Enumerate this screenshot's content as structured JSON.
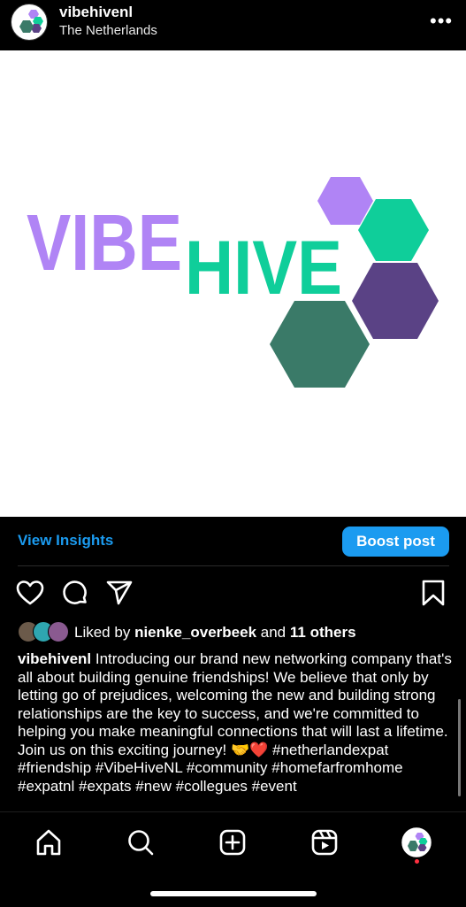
{
  "header": {
    "username": "vibehivenl",
    "location": "The Netherlands",
    "more_icon": "more-horizontal-icon"
  },
  "post": {
    "logo_text_1": "VIBE",
    "logo_text_2": "HIVE",
    "colors": {
      "purple_light": "#b084f5",
      "teal": "#0fce9a",
      "purple_dark": "#5a4285",
      "green_dark": "#3a7a68"
    }
  },
  "insights": {
    "view_insights": "View Insights",
    "boost_post": "Boost post"
  },
  "actions": {
    "like_icon": "heart-icon",
    "comment_icon": "comment-icon",
    "share_icon": "paper-plane-icon",
    "save_icon": "bookmark-icon"
  },
  "likes": {
    "prefix": "Liked by",
    "user": "nienke_overbeek",
    "connector": "and",
    "others": "11 others"
  },
  "caption": {
    "username": "vibehivenl",
    "text": "Introducing our brand new networking company that's all about building genuine friendships! We believe that only by letting go of prejudices, welcoming the new and building strong relationships are the key to success, and we're committed to helping you make meaningful connections that will last a lifetime. Join us on this exciting journey! 🤝❤️ #netherlandexpat #friendship #VibeHiveNL #community #homefarfromhome #expatnl #expats #new #collegues #event"
  },
  "nav": {
    "items": [
      "home-icon",
      "search-icon",
      "create-icon",
      "reels-icon",
      "profile-icon"
    ]
  },
  "accent_color": "#1b9bf0"
}
